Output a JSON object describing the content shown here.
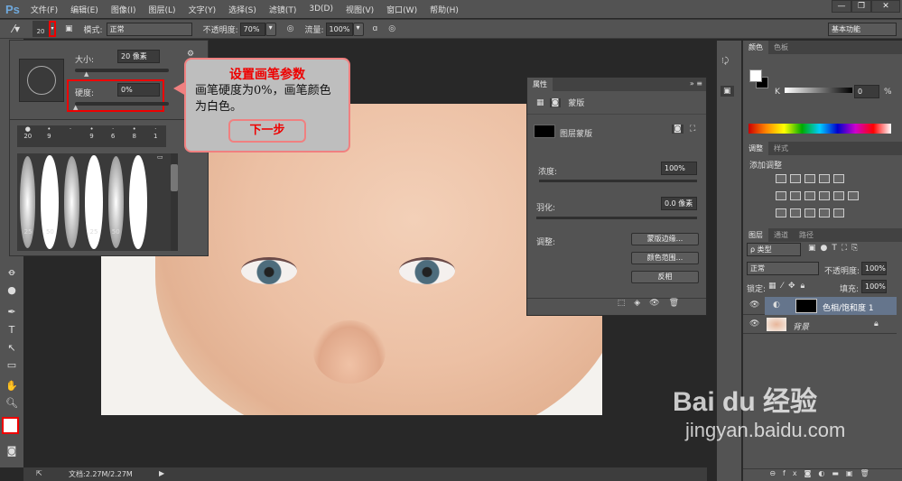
{
  "app": {
    "logo": "Ps",
    "menus": [
      "文件(F)",
      "编辑(E)",
      "图像(I)",
      "图层(L)",
      "文字(Y)",
      "选择(S)",
      "滤镜(T)",
      "3D(D)",
      "视图(V)",
      "窗口(W)",
      "帮助(H)"
    ],
    "window_buttons": [
      "—",
      "❐",
      "✕"
    ]
  },
  "options": {
    "brush_size": "20",
    "mode_label": "模式:",
    "mode_value": "正常",
    "opacity_label": "不透明度:",
    "opacity_value": "70%",
    "flow_label": "流量:",
    "flow_value": "100%",
    "workspace": "基本功能"
  },
  "brush_panel": {
    "size_label": "大小:",
    "size_value": "20 像素",
    "hardness_label": "硬度:",
    "hardness_value": "0%",
    "hardness_percent": 0,
    "recent_sizes": [
      "20",
      "9",
      "",
      "9",
      "6",
      "8",
      "1"
    ],
    "preset_labels": [
      "25",
      "50",
      "",
      "25",
      "50",
      "",
      ""
    ]
  },
  "callout": {
    "title": "设置画笔参数",
    "body": "画笔硬度为0%，画笔颜色为白色。",
    "next": "下一步"
  },
  "properties": {
    "tab": "属性",
    "mode": "蒙版",
    "mask_name": "图层蒙版",
    "density_label": "浓度:",
    "density_value": "100%",
    "feather_label": "羽化:",
    "feather_value": "0.0 像素",
    "adjust_label": "调整:",
    "btn_mask_edge": "蒙版边缘...",
    "btn_color_range": "颜色范围...",
    "btn_invert": "反相"
  },
  "color_panel": {
    "tabs": [
      "颜色",
      "色板"
    ],
    "channel": "K",
    "value": "0",
    "unit": "%"
  },
  "adjust_panel": {
    "tabs": [
      "调整",
      "样式"
    ],
    "title": "添加调整"
  },
  "layers_panel": {
    "tabs": [
      "图层",
      "通道",
      "路径"
    ],
    "filter": "ρ 类型",
    "blend": "正常",
    "opacity_label": "不透明度:",
    "opacity_value": "100%",
    "lock_label": "锁定:",
    "fill_label": "填充:",
    "fill_value": "100%",
    "layers": [
      {
        "name": "色相/饱和度 1",
        "selected": true
      },
      {
        "name": "背景",
        "selected": false
      }
    ]
  },
  "status": {
    "doc": "文档:2.27M/2.27M"
  },
  "watermark": {
    "brand": "Bai du 经验",
    "url": "jingyan.baidu.com"
  }
}
